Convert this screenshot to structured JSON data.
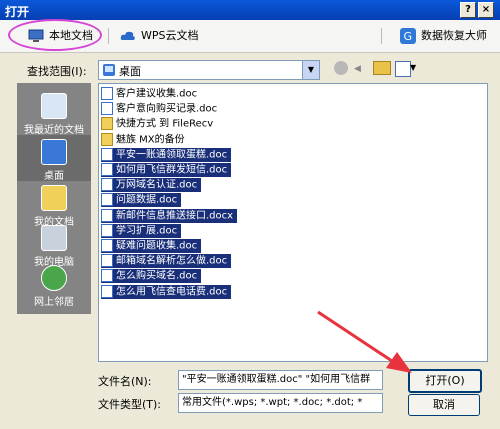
{
  "window": {
    "title": "打开",
    "help": "?",
    "close": "×"
  },
  "tabs": [
    {
      "label": "本地文档"
    },
    {
      "label": "WPS云文档"
    },
    {
      "label": "数据恢复大师"
    }
  ],
  "lookin": {
    "label": "查找范围(I):",
    "value": "桌面"
  },
  "sidebar": [
    {
      "label": "我最近的文档"
    },
    {
      "label": "桌面"
    },
    {
      "label": "我的文档"
    },
    {
      "label": "我的电脑"
    },
    {
      "label": "网上邻居"
    }
  ],
  "files": [
    {
      "name": "客户建议收集.doc",
      "type": "doc",
      "selected": false
    },
    {
      "name": "客户意向购买记录.doc",
      "type": "doc",
      "selected": false
    },
    {
      "name": "快捷方式 到 FileRecv",
      "type": "folder",
      "selected": false
    },
    {
      "name": "魅族 MX的备份",
      "type": "folder",
      "selected": false
    },
    {
      "name": "平安一账通领取蛋糕.doc",
      "type": "doc",
      "selected": true
    },
    {
      "name": "如何用飞信群发短信.doc",
      "type": "doc",
      "selected": true
    },
    {
      "name": "万网域名认证.doc",
      "type": "doc",
      "selected": true
    },
    {
      "name": "问题数据.doc",
      "type": "doc",
      "selected": true
    },
    {
      "name": "新邮件信息推送接口.docx",
      "type": "doc",
      "selected": true
    },
    {
      "name": "学习扩展.doc",
      "type": "doc",
      "selected": true
    },
    {
      "name": "疑难问题收集.doc",
      "type": "doc",
      "selected": true
    },
    {
      "name": "邮箱域名解析怎么做.doc",
      "type": "doc",
      "selected": true
    },
    {
      "name": "怎么购买域名.doc",
      "type": "doc",
      "selected": true
    },
    {
      "name": "怎么用飞信查电话费.doc",
      "type": "doc",
      "selected": true
    }
  ],
  "filename": {
    "label": "文件名(N):",
    "value": "\"平安一账通领取蛋糕.doc\" \"如何用飞信群"
  },
  "filetype": {
    "label": "文件类型(T):",
    "value": "常用文件(*.wps; *.wpt; *.doc; *.dot; *"
  },
  "buttons": {
    "open": "打开(O)",
    "cancel": "取消"
  },
  "colors": {
    "annotation_ring": "#d646d6",
    "annotation_arrow": "#e8323c",
    "selection": "#1a2f7a",
    "sidebar": "#848484"
  }
}
